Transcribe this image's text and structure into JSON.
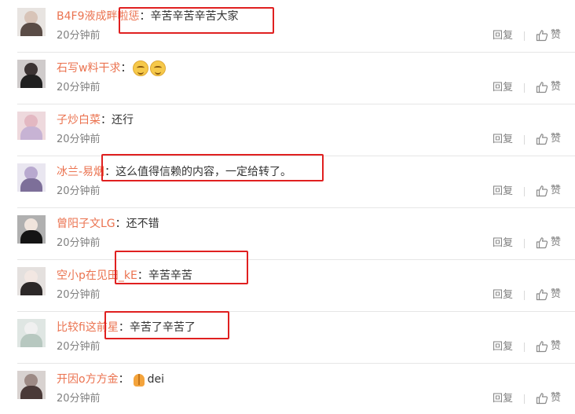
{
  "comments": [
    {
      "user": "B4F9液成畔啦惩",
      "sep": "：",
      "text": "辛苦辛苦辛苦大家",
      "emojis": [],
      "time": "20分钟前",
      "reply": "回复",
      "like": "赞",
      "avatar_colors": [
        "#e8e4e1",
        "#d8c4b8",
        "#5a4c46"
      ]
    },
    {
      "user": "石写w料干求",
      "sep": "：",
      "text": "",
      "emojis": [
        "smile-emoji",
        "smile-emoji"
      ],
      "time": "20分钟前",
      "reply": "回复",
      "like": "赞",
      "avatar_colors": [
        "#cfcbcb",
        "#3c3434",
        "#202020"
      ]
    },
    {
      "user": "子炒白菜",
      "sep": "：",
      "text": "还行",
      "emojis": [],
      "time": "20分钟前",
      "reply": "回复",
      "like": "赞",
      "avatar_colors": [
        "#eed9dd",
        "#e3b8c2",
        "#c7b3d4"
      ]
    },
    {
      "user": "冰兰-易烟",
      "sep": "：",
      "text": "这么值得信赖的内容，一定给转了。",
      "emojis": [],
      "time": "20分钟前",
      "reply": "回复",
      "like": "赞",
      "avatar_colors": [
        "#e9e6f0",
        "#b8a9cf",
        "#7d6f99"
      ]
    },
    {
      "user": "曾阳子文LG",
      "sep": "：",
      "text": "还不错",
      "emojis": [],
      "time": "20分钟前",
      "reply": "回复",
      "like": "赞",
      "avatar_colors": [
        "#b0b0b0",
        "#f0e4dc",
        "#141414"
      ]
    },
    {
      "user": "空小p在见田_kE",
      "sep": "：",
      "text": "辛苦辛苦",
      "emojis": [],
      "time": "20分钟前",
      "reply": "回复",
      "like": "赞",
      "avatar_colors": [
        "#e4e0de",
        "#f2e7e2",
        "#2c2828"
      ]
    },
    {
      "user": "比较fi这前星",
      "sep": "：",
      "text": "辛苦了辛苦了",
      "emojis": [],
      "time": "20分钟前",
      "reply": "回复",
      "like": "赞",
      "avatar_colors": [
        "#dfe6e3",
        "#f0f0f0",
        "#b7c8c0"
      ]
    },
    {
      "user": "开因o方方金",
      "sep": "：",
      "text": "dei",
      "emojis": [
        "pray-emoji"
      ],
      "time": "20分钟前",
      "reply": "回复",
      "like": "赞",
      "avatar_colors": [
        "#d8d2d0",
        "#9d8a85",
        "#4a3a38"
      ]
    }
  ],
  "colors": {
    "username": "#eb7350",
    "meta": "#808080",
    "highlight": "#e02020"
  }
}
